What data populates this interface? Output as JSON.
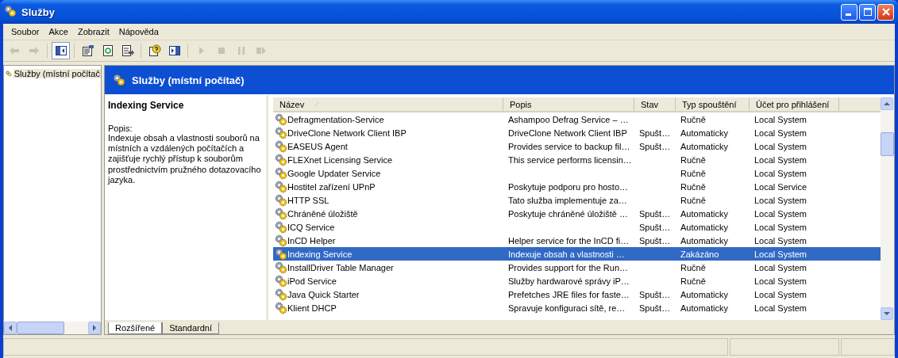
{
  "window": {
    "title": "Služby"
  },
  "menu": [
    "Soubor",
    "Akce",
    "Zobrazit",
    "Nápověda"
  ],
  "toolbar": [
    {
      "kind": "back",
      "disabled": true,
      "pressed": false
    },
    {
      "kind": "forward",
      "disabled": true,
      "pressed": false
    },
    {
      "kind": "sep"
    },
    {
      "kind": "tree",
      "disabled": false,
      "pressed": true
    },
    {
      "kind": "sep"
    },
    {
      "kind": "properties",
      "disabled": false,
      "pressed": false
    },
    {
      "kind": "refresh",
      "disabled": false,
      "pressed": false
    },
    {
      "kind": "export",
      "disabled": false,
      "pressed": false
    },
    {
      "kind": "sep"
    },
    {
      "kind": "help",
      "disabled": false,
      "pressed": false
    },
    {
      "kind": "pane",
      "disabled": false,
      "pressed": false
    },
    {
      "kind": "sep"
    },
    {
      "kind": "play",
      "disabled": true,
      "pressed": false
    },
    {
      "kind": "stop",
      "disabled": true,
      "pressed": false
    },
    {
      "kind": "pause",
      "disabled": true,
      "pressed": false
    },
    {
      "kind": "restart",
      "disabled": true,
      "pressed": false
    }
  ],
  "tree": {
    "items": [
      {
        "label": "Služby (místní počítač",
        "selected": true
      }
    ]
  },
  "panel": {
    "title": "Služby (místní počítač)"
  },
  "details": {
    "name": "Indexing Service",
    "label": "Popis:",
    "text": "Indexuje obsah a vlastnosti souborů na místních a vzdálených počítačích a zajišťuje rychlý přístup k souborům prostřednictvím pružného dotazovacího jazyka."
  },
  "table": {
    "columns": [
      {
        "label": "Název",
        "sorted": true
      },
      {
        "label": "Popis",
        "sorted": false
      },
      {
        "label": "Stav",
        "sorted": false
      },
      {
        "label": "Typ spouštění",
        "sorted": false
      },
      {
        "label": "Účet pro přihlášení",
        "sorted": false
      }
    ],
    "rows": [
      {
        "selected": false,
        "cells": [
          "Defragmentation-Service",
          "Ashampoo Defrag Service – …",
          "",
          "Ručně",
          "Local System"
        ]
      },
      {
        "selected": false,
        "cells": [
          "DriveClone Network Client IBP",
          "DriveClone Network Client IBP",
          "Spušt…",
          "Automaticky",
          "Local System"
        ]
      },
      {
        "selected": false,
        "cells": [
          "EASEUS Agent",
          "Provides service to backup fil…",
          "Spušt…",
          "Automaticky",
          "Local System"
        ]
      },
      {
        "selected": false,
        "cells": [
          "FLEXnet Licensing Service",
          "This service performs licensin…",
          "",
          "Ručně",
          "Local System"
        ]
      },
      {
        "selected": false,
        "cells": [
          "Google Updater Service",
          "",
          "",
          "Ručně",
          "Local System"
        ]
      },
      {
        "selected": false,
        "cells": [
          "Hostitel zařízení UPnP",
          "Poskytuje podporu pro hosto…",
          "",
          "Ručně",
          "Local Service"
        ]
      },
      {
        "selected": false,
        "cells": [
          "HTTP SSL",
          "Tato služba implementuje za…",
          "",
          "Ručně",
          "Local System"
        ]
      },
      {
        "selected": false,
        "cells": [
          "Chráněné úložiště",
          "Poskytuje chráněné úložiště …",
          "Spušt…",
          "Automaticky",
          "Local System"
        ]
      },
      {
        "selected": false,
        "cells": [
          "ICQ Service",
          "",
          "Spušt…",
          "Automaticky",
          "Local System"
        ]
      },
      {
        "selected": false,
        "cells": [
          "InCD Helper",
          "Helper service for the InCD fi…",
          "Spušt…",
          "Automaticky",
          "Local System"
        ]
      },
      {
        "selected": true,
        "cells": [
          "Indexing Service",
          "Indexuje obsah a vlastnosti …",
          "",
          "Zakázáno",
          "Local System"
        ]
      },
      {
        "selected": false,
        "cells": [
          "InstallDriver Table Manager",
          "Provides support for the Run…",
          "",
          "Ručně",
          "Local System"
        ]
      },
      {
        "selected": false,
        "cells": [
          "iPod Service",
          "Služby hardwarové správy iP…",
          "",
          "Ručně",
          "Local System"
        ]
      },
      {
        "selected": false,
        "cells": [
          "Java Quick Starter",
          "Prefetches JRE files for faste…",
          "Spušt…",
          "Automaticky",
          "Local System"
        ]
      },
      {
        "selected": false,
        "cells": [
          "Klient DHCP",
          "Spravuje konfiguraci sítě, re…",
          "Spušt…",
          "Automaticky",
          "Local System"
        ]
      }
    ]
  },
  "tabs": [
    {
      "label": "Rozšířené",
      "selected": true
    },
    {
      "label": "Standardní",
      "selected": false
    }
  ]
}
